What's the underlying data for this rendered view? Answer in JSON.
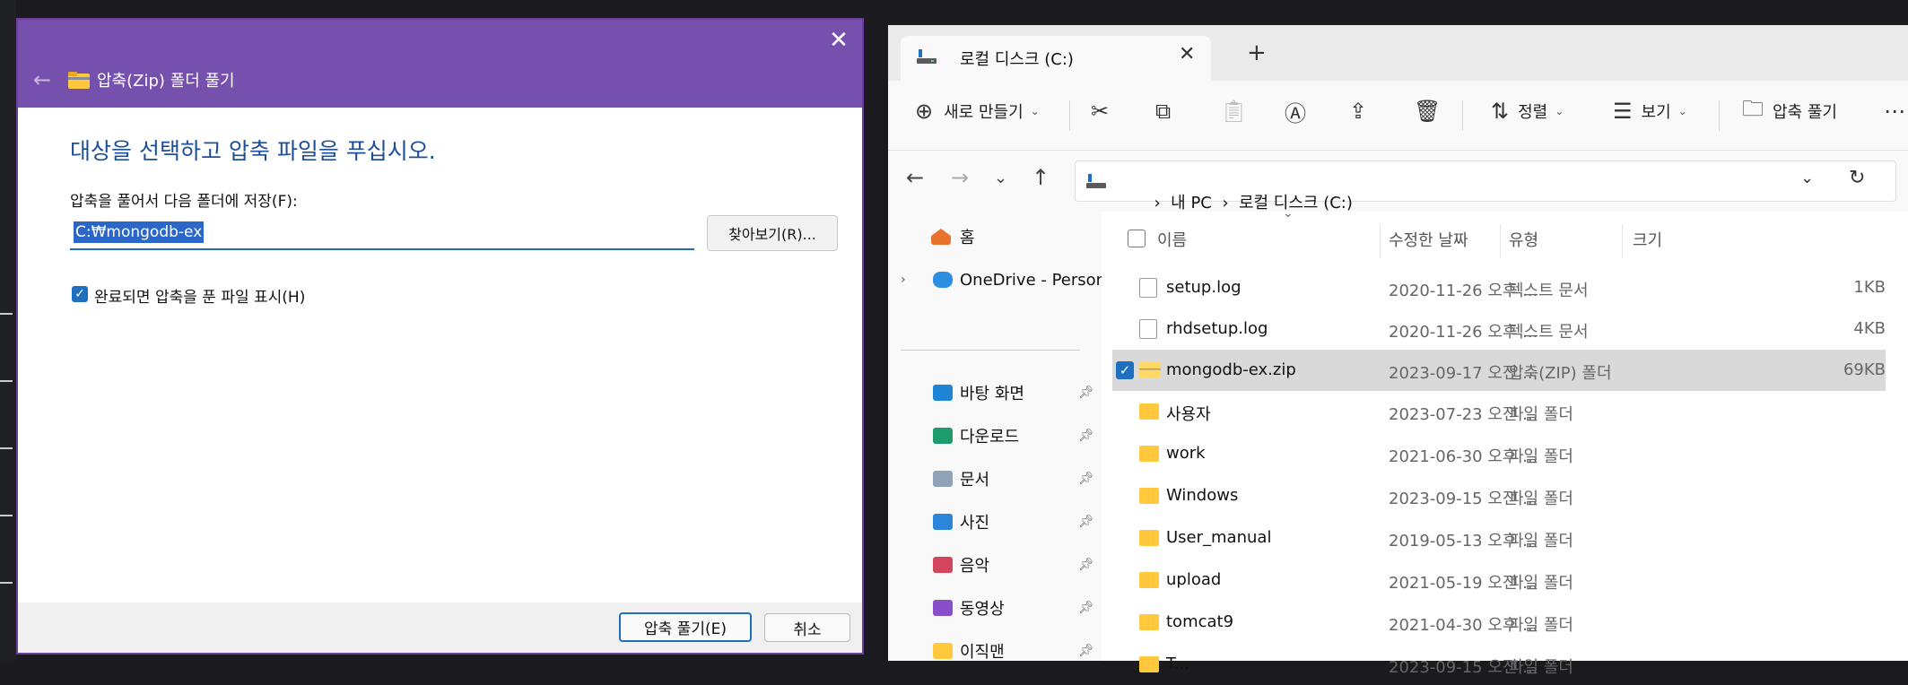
{
  "dialog": {
    "title": "압축(Zip) 폴더 풀기",
    "heading": "대상을 선택하고 압축 파일을 푸십시오.",
    "dest_label": "압축을 풀어서 다음 폴더에 저장(F):",
    "dest_path": "C:₩mongodb-ex",
    "browse_label": "찾아보기(R)...",
    "show_files_label": "완료되면 압축을 푼 파일 표시(H)",
    "show_files_checked": true,
    "extract_label": "압축 풀기(E)",
    "cancel_label": "취소",
    "accent_color": "#7650ad"
  },
  "explorer": {
    "tab_title": "로컬 디스크 (C:)",
    "toolbar": {
      "new_label": "새로 만들기",
      "sort_label": "정렬",
      "view_label": "보기",
      "extract_label": "압축 풀기"
    },
    "breadcrumb": [
      "내 PC",
      "로컬 디스크 (C:)"
    ],
    "nav": {
      "home": "홈",
      "onedrive": "OneDrive - Persona",
      "desktop": "바탕 화면",
      "downloads": "다운로드",
      "documents": "문서",
      "pictures": "사진",
      "music": "음악",
      "videos": "동영상",
      "user_folder": "이직맨"
    },
    "columns": {
      "name": "이름",
      "modified": "수정한 날짜",
      "type": "유형",
      "size": "크기"
    },
    "files": [
      {
        "name": "setup.log",
        "modified": "2020-11-26 오후 ...",
        "type": "텍스트 문서",
        "size": "1KB",
        "icon": "text-file-icon"
      },
      {
        "name": "rhdsetup.log",
        "modified": "2020-11-26 오후 ...",
        "type": "텍스트 문서",
        "size": "4KB",
        "icon": "text-file-icon"
      },
      {
        "name": "mongodb-ex.zip",
        "modified": "2023-09-17 오전 ...",
        "type": "압축(ZIP) 폴더",
        "size": "69KB",
        "icon": "zip-folder-icon",
        "selected": true
      },
      {
        "name": "사용자",
        "modified": "2023-07-23 오전 ...",
        "type": "파일 폴더",
        "size": "",
        "icon": "folder-icon"
      },
      {
        "name": "work",
        "modified": "2021-06-30 오후 ...",
        "type": "파일 폴더",
        "size": "",
        "icon": "folder-icon"
      },
      {
        "name": "Windows",
        "modified": "2023-09-15 오전 ...",
        "type": "파일 폴더",
        "size": "",
        "icon": "folder-icon"
      },
      {
        "name": "User_manual",
        "modified": "2019-05-13 오후 ...",
        "type": "파일 폴더",
        "size": "",
        "icon": "folder-icon"
      },
      {
        "name": "upload",
        "modified": "2021-05-19 오전 ...",
        "type": "파일 폴더",
        "size": "",
        "icon": "folder-icon"
      },
      {
        "name": "tomcat9",
        "modified": "2021-04-30 오후 ...",
        "type": "파일 폴더",
        "size": "",
        "icon": "folder-icon"
      },
      {
        "name": "T...",
        "modified": "2023-09-15 오전 ...",
        "type": "파일 폴더",
        "size": "",
        "icon": "folder-icon"
      }
    ]
  }
}
